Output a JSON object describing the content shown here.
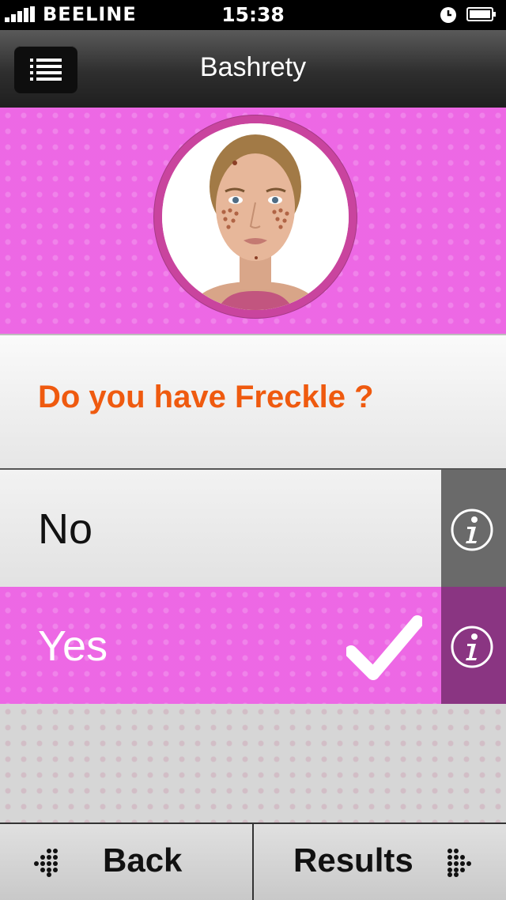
{
  "status_bar": {
    "carrier": "BEELINE",
    "time": "15:38"
  },
  "nav": {
    "title": "Bashrety",
    "menu_icon": "list-icon"
  },
  "question": {
    "text": "Do you have Freckle ?"
  },
  "options": [
    {
      "label": "No",
      "selected": false,
      "info_icon": "info-icon"
    },
    {
      "label": "Yes",
      "selected": true,
      "info_icon": "info-icon"
    }
  ],
  "footer": {
    "back_label": "Back",
    "results_label": "Results"
  },
  "colors": {
    "accent_pink": "#ec5fe3",
    "question_orange": "#ef5a0f",
    "selected_info": "#8a3582"
  }
}
